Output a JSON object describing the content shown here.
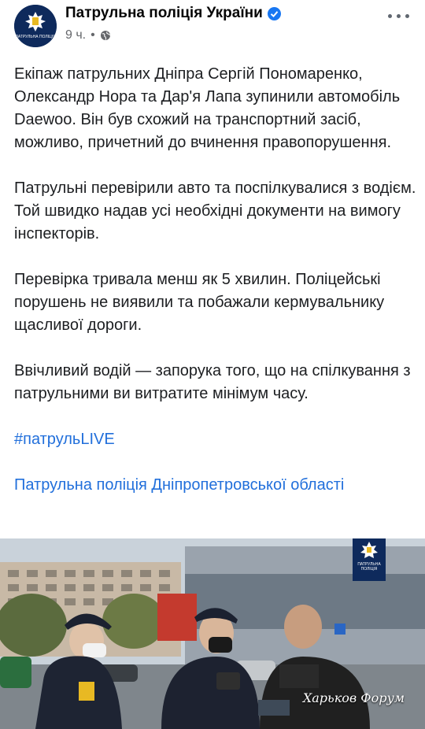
{
  "header": {
    "page_name": "Патрульна поліція України",
    "timestamp": "9 ч.",
    "separator": "•",
    "avatar_label": "ПАТРУЛЬНА ПОЛІЦІЯ"
  },
  "post": {
    "paragraphs": [
      "Екіпаж патрульних Дніпра Сергій Пономаренко, Олександр Нора та Дар'я Лапа зупинили автомобіль Daewoo. Він був схожий на транспортний засіб, можливо, причетний до вчинення правопорушення.",
      "Патрульні перевірили авто та поспілкувалися з водієм. Той швидко надав усі необхідні документи на вимогу інспекторів.",
      "Перевірка тривала менш як 5 хвилин. Поліцейські порушень не виявили та побажали кермувальнику щасливої дороги.",
      "Ввічливий водій — запорука того, що на спілкування з патрульними ви витратите мінімум часу."
    ],
    "hashtag": "#патрульLIVE",
    "page_link": "Патрульна поліція Дніпропетровської області"
  },
  "photo": {
    "watermark": "Харьков Форум",
    "logo_label": "ПАТРУЛЬНА ПОЛІЦІЯ"
  },
  "colors": {
    "link": "#216fdb",
    "verified": "#1877f2",
    "police_navy": "#0e2a5c"
  }
}
